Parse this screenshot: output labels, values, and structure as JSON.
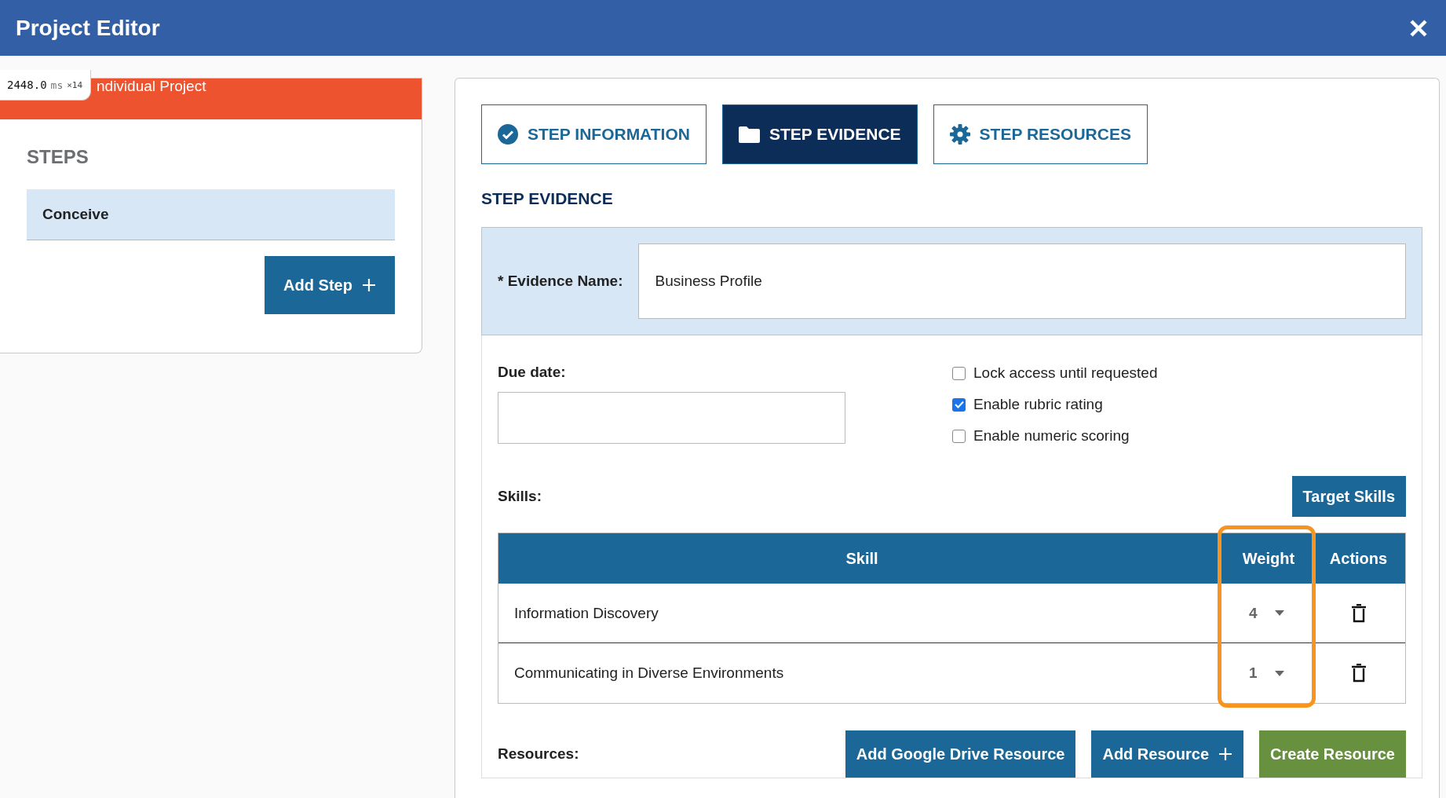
{
  "window": {
    "title": "Project Editor"
  },
  "debug_overlay": {
    "value": "2448.0",
    "unit": "ms",
    "count": "×14"
  },
  "sidebar": {
    "banner": "ndividual Project",
    "heading": "STEPS",
    "steps": [
      {
        "label": "Conceive",
        "selected": true
      }
    ],
    "add_button": "Add Step"
  },
  "tabs": [
    {
      "label": "STEP INFORMATION",
      "selected": false
    },
    {
      "label": "STEP EVIDENCE",
      "selected": true
    },
    {
      "label": "STEP RESOURCES",
      "selected": false
    }
  ],
  "section_title": "STEP EVIDENCE",
  "evidence_name": {
    "label": "* Evidence Name:",
    "value": "Business Profile"
  },
  "due_date": {
    "label": "Due date:"
  },
  "options": [
    {
      "label": "Lock access until requested",
      "checked": false
    },
    {
      "label": "Enable rubric rating",
      "checked": true
    },
    {
      "label": "Enable numeric scoring",
      "checked": false
    }
  ],
  "skills": {
    "label": "Skills:",
    "target_button": "Target Skills",
    "columns": [
      "Skill",
      "Weight",
      "Actions"
    ],
    "rows": [
      {
        "skill": "Information Discovery",
        "weight": "4"
      },
      {
        "skill": "Communicating in Diverse Environments",
        "weight": "1"
      }
    ]
  },
  "resources": {
    "label": "Resources:",
    "buttons": [
      {
        "label": "Add Google Drive Resource",
        "kind": "primary"
      },
      {
        "label": "Add Resource",
        "kind": "add"
      },
      {
        "label": "Create Resource",
        "kind": "create"
      }
    ]
  }
}
